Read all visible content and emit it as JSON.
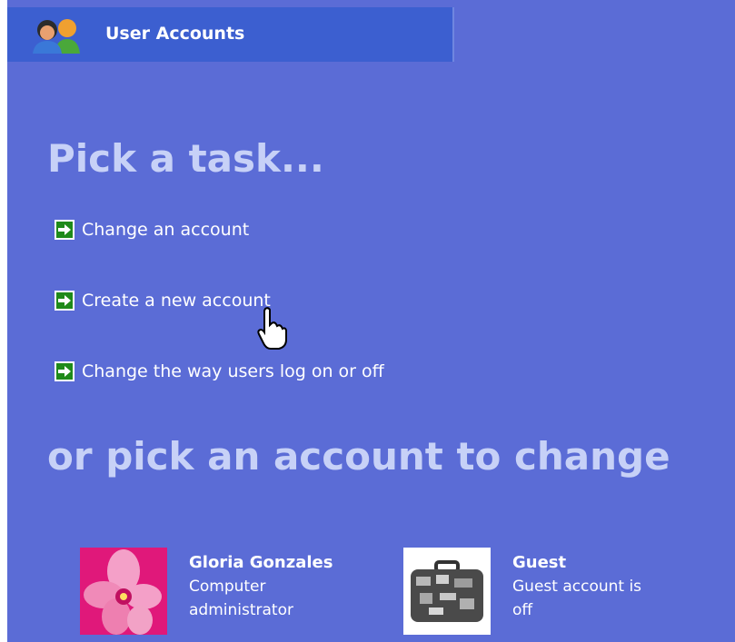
{
  "header": {
    "title": "User Accounts"
  },
  "tasks_heading": "Pick a task...",
  "tasks": [
    {
      "label": "Change an account"
    },
    {
      "label": "Create a new account"
    },
    {
      "label": "Change the way users log on or off"
    }
  ],
  "accounts_heading": "or pick an account to change",
  "accounts": [
    {
      "name": "Gloria Gonzales",
      "desc_line1": "Computer",
      "desc_line2": "administrator",
      "picture": "pink-flower"
    },
    {
      "name": "Guest",
      "desc_line1": "Guest account is",
      "desc_line2": "off",
      "picture": "suitcase"
    }
  ],
  "colors": {
    "background": "#5b6cd6",
    "header": "#3c5fd0",
    "heading_text": "#c7d1f7",
    "arrow_green": "#1f8a1a"
  },
  "icons": {
    "header": "users-icon",
    "task_arrow": "green-arrow-icon",
    "cursor": "hand-pointer-cursor"
  }
}
